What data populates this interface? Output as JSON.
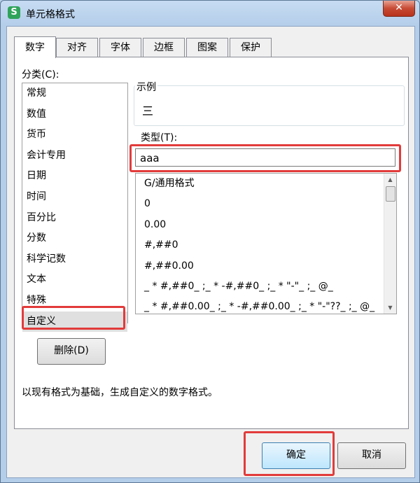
{
  "window": {
    "title": "单元格格式",
    "app_icon": "S",
    "close_label": "✕"
  },
  "tabs": [
    {
      "label": "数字",
      "active": true
    },
    {
      "label": "对齐",
      "active": false
    },
    {
      "label": "字体",
      "active": false
    },
    {
      "label": "边框",
      "active": false
    },
    {
      "label": "图案",
      "active": false
    },
    {
      "label": "保护",
      "active": false
    }
  ],
  "category": {
    "label": "分类(C):",
    "items": [
      "常规",
      "数值",
      "货币",
      "会计专用",
      "日期",
      "时间",
      "百分比",
      "分数",
      "科学记数",
      "文本",
      "特殊",
      "自定义"
    ],
    "selected": "自定义"
  },
  "delete_button": "删除(D)",
  "sample": {
    "legend": "示例",
    "value": "三"
  },
  "type": {
    "label": "类型(T):",
    "value": "aaa",
    "formats": [
      "G/通用格式",
      "0",
      "0.00",
      "#,##0",
      "#,##0.00",
      "_ * #,##0_ ;_ * -#,##0_ ;_ * \"-\"_ ;_ @_",
      "_ * #,##0.00_ ;_ * -#,##0.00_ ;_ * \"-\"??_ ;_ @_"
    ]
  },
  "description": "以现有格式为基础，生成自定义的数字格式。",
  "buttons": {
    "ok": "确定",
    "cancel": "取消"
  },
  "colors": {
    "highlight": "#e23b3b",
    "title_bg": "#b4cde9",
    "close": "#c74a34"
  }
}
